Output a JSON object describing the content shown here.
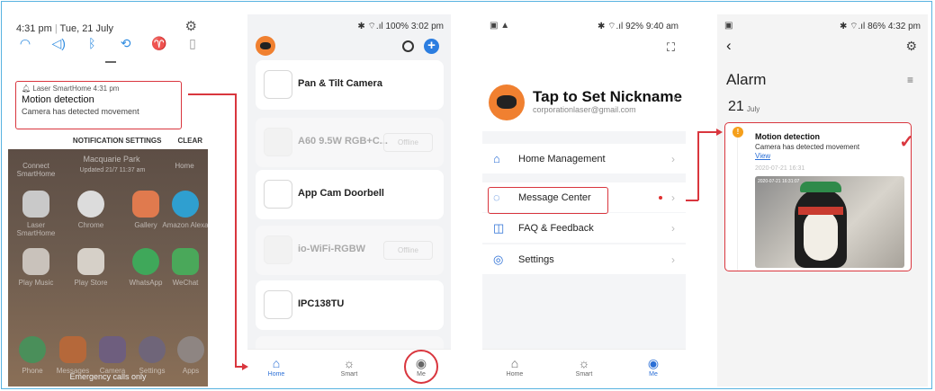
{
  "panel1": {
    "status_time": "4:31 pm",
    "status_date": "Tue, 21 July",
    "quick_settings": [
      "wifi-icon",
      "sound-icon",
      "bluetooth-icon",
      "rotate-icon",
      "flashlight-icon",
      "battery-saver-icon"
    ],
    "notification": {
      "app_line": "Laser SmartHome  4:31 pm",
      "title": "Motion detection",
      "body": "Camera has detected movement"
    },
    "actions": {
      "settings": "NOTIFICATION SETTINGS",
      "clear": "CLEAR"
    },
    "home": {
      "top_left": "Connect SmartHome",
      "widget_title": "Macquarie Park",
      "widget_updated": "Updated 21/7 11:37 am",
      "top_right": "Home",
      "apps_row1": [
        "Laser SmartHome",
        "Chrome",
        "Gallery",
        "Amazon Alexa"
      ],
      "apps_row2": [
        "Play Music",
        "Play Store",
        "WhatsApp",
        "WeChat"
      ],
      "dock": [
        "Phone",
        "Messages",
        "Camera",
        "Settings",
        "Apps"
      ],
      "emergency": "Emergency calls only"
    }
  },
  "panel2": {
    "status": "100% 3:02 pm",
    "devices": [
      {
        "name": "Pan & Tilt Camera",
        "offline": ""
      },
      {
        "name": "A60 9.5W RGB+C...",
        "offline": "Offline"
      },
      {
        "name": "App Cam Doorbell",
        "offline": ""
      },
      {
        "name": "io-WiFi-RGBW",
        "offline": "Offline"
      },
      {
        "name": "IPC138TU",
        "offline": ""
      }
    ],
    "tabs": [
      "Home",
      "Smart",
      "Me"
    ]
  },
  "panel3": {
    "status": "92% 9:40 am",
    "nickname": "Tap to Set Nickname",
    "email": "corporationlaser@gmail.com",
    "menu": [
      "Home Management",
      "Message Center",
      "FAQ & Feedback",
      "Settings"
    ],
    "tabs": [
      "Home",
      "Smart",
      "Me"
    ]
  },
  "panel4": {
    "status": "86% 4:32 pm",
    "title": "Alarm",
    "date_day": "21",
    "date_month": "July",
    "alarm": {
      "badge": "!",
      "title": "Motion detection",
      "body": "Camera has detected movement",
      "link": "View",
      "time": "2020-07-21 16:31",
      "snapshot_ts": "2020-07-21 16:31:07"
    }
  },
  "colors": {
    "accent_red": "#d9363e",
    "brand_blue": "#2b6fd6",
    "robot_orange": "#f08030",
    "frame_blue": "#58b3e0"
  }
}
